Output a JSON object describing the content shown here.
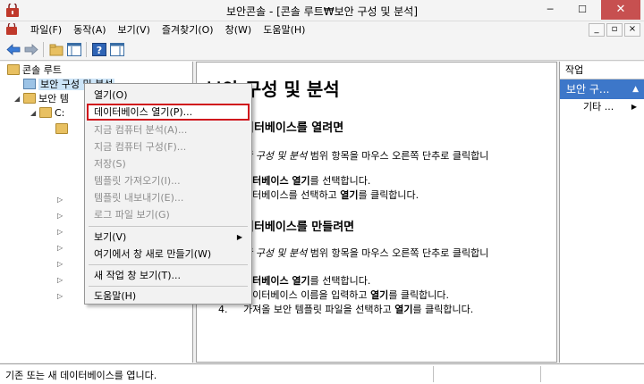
{
  "window": {
    "title": "보안콘솔 - [콘솔 루트₩보안 구성 및 분석]",
    "minimize": "─",
    "maximize": "☐",
    "close": "✕"
  },
  "menubar": {
    "items": [
      "파일(F)",
      "동작(A)",
      "보기(V)",
      "즐겨찾기(O)",
      "창(W)",
      "도움말(H)"
    ],
    "mdi": [
      "_",
      "▫",
      "×"
    ]
  },
  "tree": {
    "root": "콘솔 루트",
    "node1": "보안 구성 및 분석",
    "node2": "보안 템",
    "node3": "C:"
  },
  "content": {
    "title": "보안 구성 및 분석",
    "h_open": "데이터베이스를 열려면",
    "h_open_display": "이터베이스를 열려면",
    "open_step1_prefix": "안 구성 및 분석",
    "open_step1_rest": " 범위 항목을 마우스 오른쪽 단추로 클릭합니",
    "open_step2_bold": "이터베이스 열기",
    "open_step2_rest": "를 선택합니다.",
    "open_step3_prefix": "이터베이스를 선택하고 ",
    "open_step3_bold": "열기",
    "open_step3_rest": "를 클릭합니다.",
    "h_create_display": "이터베이스를 만들려면",
    "create_step1_prefix": "안 구성 및 분석",
    "create_step1_rest": " 범위 항목을 마우스 오른쪽 단추로 클릭합니",
    "create_step2_bold": "이터베이스 열기",
    "create_step2_rest": "를 선택합니다.",
    "create_step3_prefix": "데이터베이스 이름을 입력하고 ",
    "create_step3_bold": "열기",
    "create_step3_rest": "를 클릭합니다.",
    "create_step4_num": "4.",
    "create_step4_prefix": "가져올 보안 템플릿 파일을 선택하고 ",
    "create_step4_bold": "열기",
    "create_step4_rest": "를 클릭합니다."
  },
  "actions": {
    "header": "작업",
    "group": "보안 구...",
    "group_arrow": "▲",
    "item": "기타 ...",
    "item_arrow": "▶"
  },
  "context_menu": {
    "items": [
      {
        "label": "열기(O)",
        "enabled": true
      },
      {
        "label": "데이터베이스 열기(P)...",
        "enabled": true,
        "highlighted": true
      },
      {
        "label": "지금 컴퓨터 분석(A)...",
        "enabled": false
      },
      {
        "label": "지금 컴퓨터 구성(F)...",
        "enabled": false
      },
      {
        "label": "저장(S)",
        "enabled": false
      },
      {
        "label": "템플릿 가져오기(I)...",
        "enabled": false
      },
      {
        "label": "템플릿 내보내기(E)...",
        "enabled": false
      },
      {
        "label": "로그 파일 보기(G)",
        "enabled": false
      },
      {
        "label": "보기(V)",
        "enabled": true,
        "submenu": true
      },
      {
        "label": "여기에서 창 새로 만들기(W)",
        "enabled": true
      },
      {
        "label": "새 작업 창 보기(T)...",
        "enabled": true
      },
      {
        "label": "도움말(H)",
        "enabled": true
      }
    ],
    "submenu_arrow": "▶"
  },
  "status": {
    "text": "기존 또는 새 데이터베이스를 엽니다."
  },
  "colors": {
    "accent": "#3d77c9",
    "highlight_border": "#d0141c",
    "close_button": "#c75050"
  }
}
